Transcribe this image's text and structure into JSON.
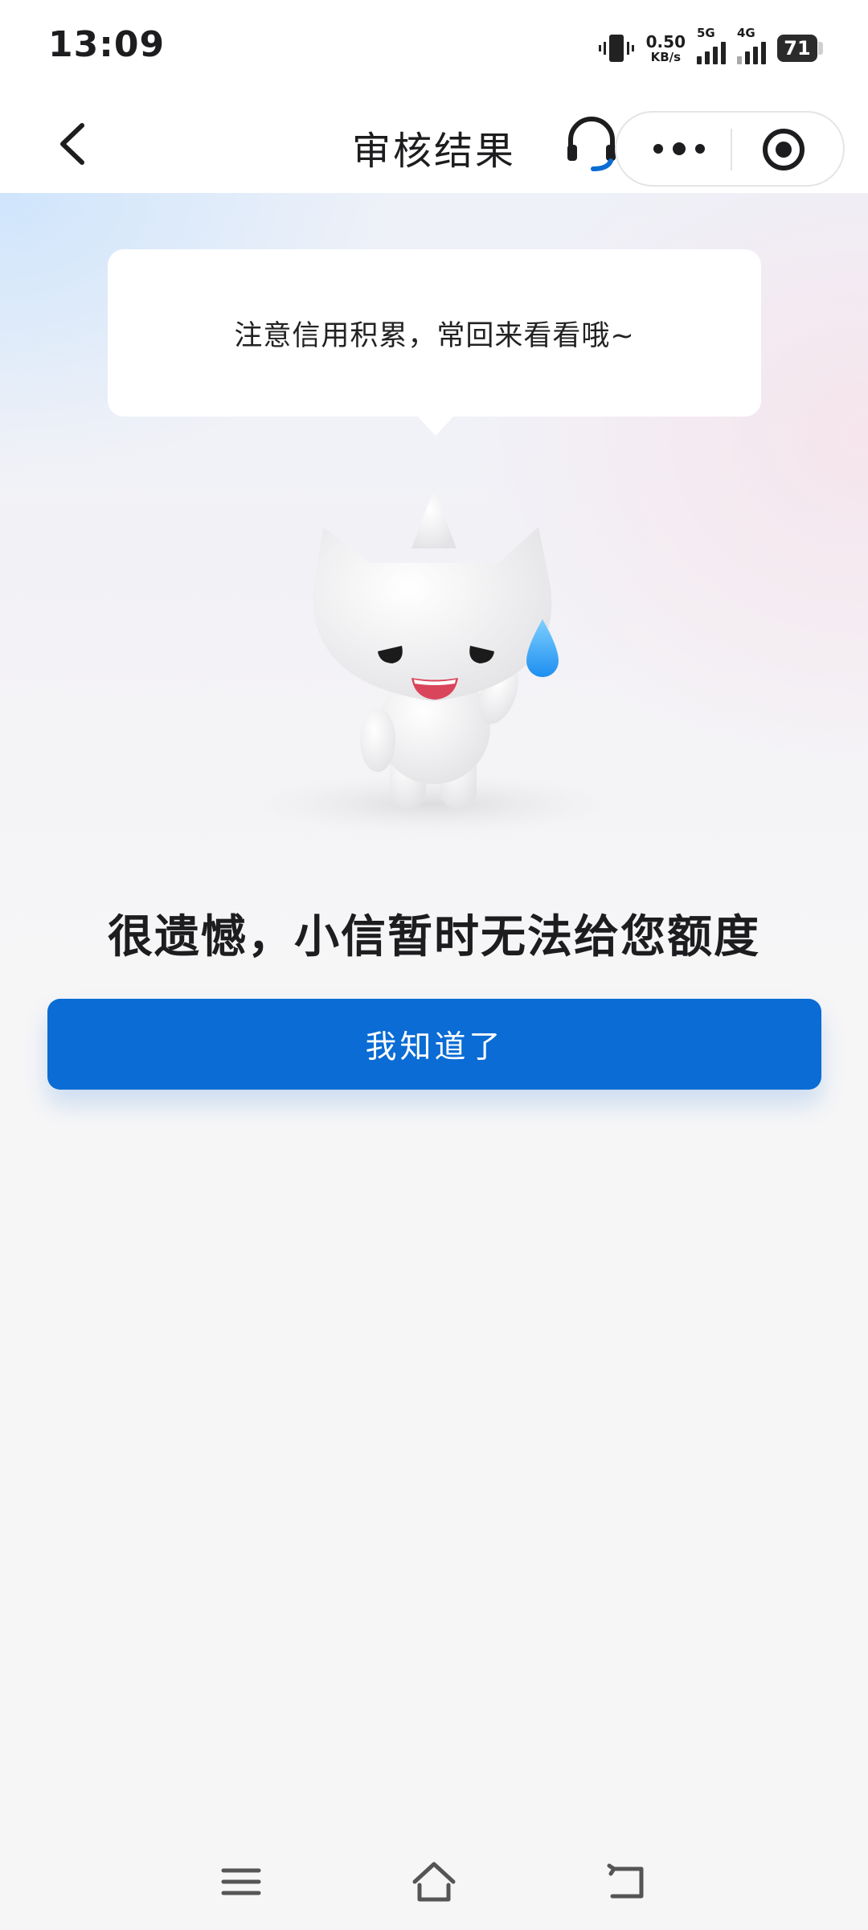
{
  "status_bar": {
    "time": "13:09",
    "net_speed_value": "0.50",
    "net_speed_unit": "KB/s",
    "sim1_label": "5G",
    "sim2_label": "4G",
    "battery_level": "71",
    "icons": [
      "vibrate-icon",
      "signal-icon",
      "battery-icon"
    ]
  },
  "nav": {
    "title": "审核结果",
    "icons": [
      "back-icon",
      "headset-icon",
      "more-icon",
      "target-icon"
    ]
  },
  "bubble": {
    "text": "注意信用积累，常回来看看哦~"
  },
  "result": {
    "message": "很遗憾，小信暂时无法给您额度"
  },
  "actions": {
    "ok_label": "我知道了"
  },
  "system_nav": {
    "icons": [
      "menu-icon",
      "home-icon",
      "back-nav-icon"
    ]
  },
  "colors": {
    "primary": "#0a6cd4",
    "page_bg": "#f6f6f7",
    "water_drop": "#2a9ef2"
  }
}
